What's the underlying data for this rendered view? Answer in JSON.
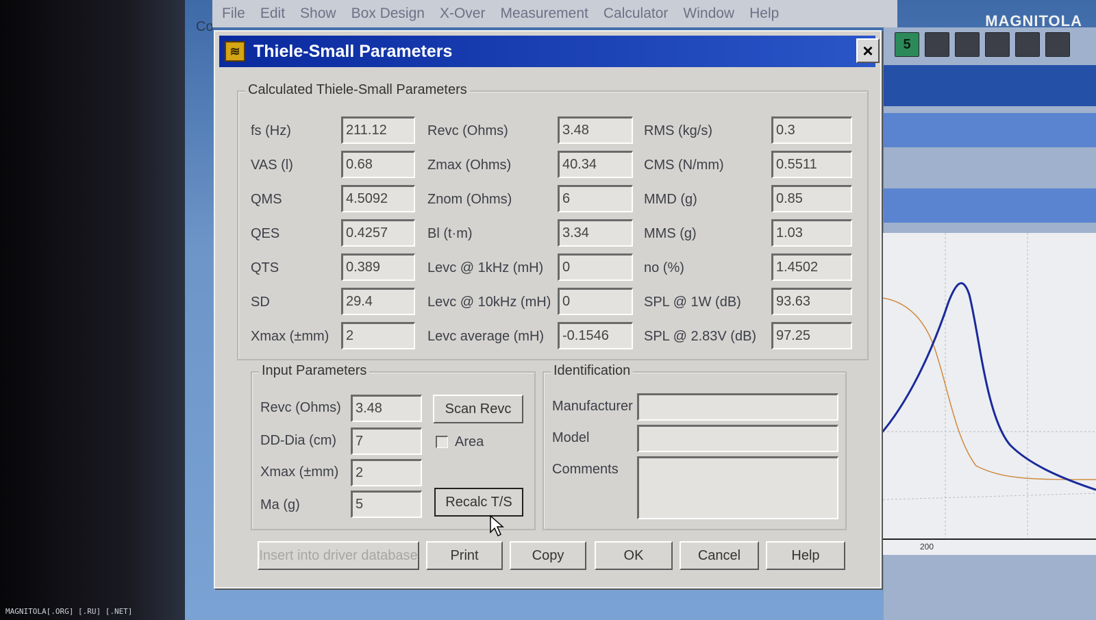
{
  "menubar": {
    "items": [
      "File",
      "Edit",
      "Show",
      "Box Design",
      "X-Over",
      "Measurement",
      "Calculator",
      "Window",
      "Help"
    ]
  },
  "background": {
    "co_label": "Co",
    "toolbar_number": "5",
    "watermark": "MAGNITOLA",
    "plot_tick": "200"
  },
  "footer": "MAGNITOLA[.ORG] [.RU] [.NET]",
  "dialog": {
    "title": "Thiele-Small Parameters",
    "close_label": "×",
    "calculated": {
      "legend": "Calculated Thiele-Small Parameters",
      "col1": [
        {
          "label": "fs (Hz)",
          "value": "211.12"
        },
        {
          "label": "VAS (l)",
          "value": "0.68"
        },
        {
          "label": "QMS",
          "value": "4.5092"
        },
        {
          "label": "QES",
          "value": "0.4257"
        },
        {
          "label": "QTS",
          "value": "0.389"
        },
        {
          "label": "SD",
          "value": "29.4"
        },
        {
          "label": "Xmax (±mm)",
          "value": "2"
        }
      ],
      "col2": [
        {
          "label": "Revc (Ohms)",
          "value": "3.48"
        },
        {
          "label": "Zmax (Ohms)",
          "value": "40.34"
        },
        {
          "label": "Znom (Ohms)",
          "value": "6"
        },
        {
          "label": "Bl (t·m)",
          "value": "3.34"
        },
        {
          "label": "Levc @ 1kHz (mH)",
          "value": "0"
        },
        {
          "label": "Levc @ 10kHz (mH)",
          "value": "0"
        },
        {
          "label": "Levc average (mH)",
          "value": "-0.1546"
        }
      ],
      "col3": [
        {
          "label": "RMS (kg/s)",
          "value": "0.3"
        },
        {
          "label": "CMS (N/mm)",
          "value": "0.5511"
        },
        {
          "label": "MMD (g)",
          "value": "0.85"
        },
        {
          "label": "MMS (g)",
          "value": "1.03"
        },
        {
          "label": "no (%)",
          "value": "1.4502"
        },
        {
          "label": "SPL @ 1W (dB)",
          "value": "93.63"
        },
        {
          "label": "SPL @ 2.83V (dB)",
          "value": "97.25"
        }
      ]
    },
    "input": {
      "legend": "Input Parameters",
      "rows": [
        {
          "label": "Revc (Ohms)",
          "value": "3.48"
        },
        {
          "label": "DD-Dia (cm)",
          "value": "7"
        },
        {
          "label": "Xmax (±mm)",
          "value": "2"
        },
        {
          "label": "Ma (g)",
          "value": "5"
        }
      ],
      "scan_label": "Scan Revc",
      "area_label": "Area",
      "area_checked": false,
      "recalc_label": "Recalc T/S"
    },
    "identification": {
      "legend": "Identification",
      "manufacturer_label": "Manufacturer",
      "manufacturer_value": "",
      "model_label": "Model",
      "model_value": "",
      "comments_label": "Comments",
      "comments_value": ""
    },
    "buttons": {
      "insert": "Insert into driver database",
      "print": "Print",
      "copy": "Copy",
      "ok": "OK",
      "cancel": "Cancel",
      "help": "Help"
    }
  }
}
